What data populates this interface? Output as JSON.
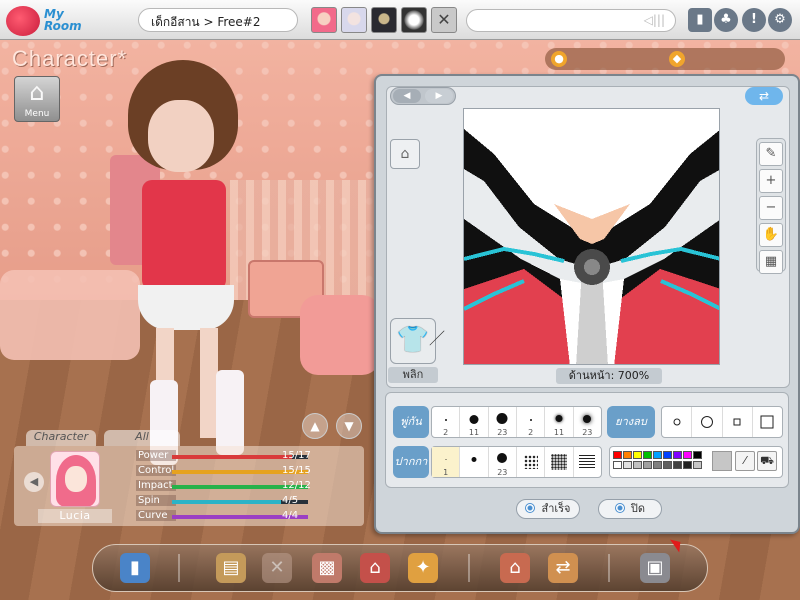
{
  "topbar": {
    "logo_text": "My Room",
    "room_title": "เด็กอีสาน > Free#2",
    "chat_placeholder": "",
    "avatars": [
      "pink-hair-avatar",
      "white-hair-avatar",
      "dark-avatar",
      "gray-avatar"
    ],
    "close_glyph": "✕"
  },
  "left": {
    "heading": "Character*",
    "menu_label": "Menu",
    "tabs": [
      "Character",
      "All"
    ],
    "character_name": "Lucia",
    "stats": [
      {
        "name": "Power",
        "value": "15/17",
        "fraction": 0.88,
        "color": "#d93a3a"
      },
      {
        "name": "Control",
        "value": "15/15",
        "fraction": 1.0,
        "color": "#e6a21f"
      },
      {
        "name": "Impact",
        "value": "12/12",
        "fraction": 1.0,
        "color": "#27b24a"
      },
      {
        "name": "Spin",
        "value": "4/5",
        "fraction": 0.8,
        "color": "#2bb3c7"
      },
      {
        "name": "Curve",
        "value": "4/4",
        "fraction": 1.0,
        "color": "#9b3fc4"
      }
    ]
  },
  "editor": {
    "flip_label": "พลิก",
    "canvas_caption": "ด้านหน้า: 700%",
    "brush_label": "พู่กัน",
    "pen_label": "ปากกา",
    "eraser_label": "ยางลบ",
    "brush_sizes": [
      "2",
      "11",
      "23",
      "2",
      "11",
      "23"
    ],
    "pen_sizes": [
      "1",
      "",
      "23",
      "",
      "",
      ""
    ],
    "ok_label": "สำเร็จ",
    "close_label": "ปิด",
    "palette": [
      "#ff0000",
      "#ff8000",
      "#ffff00",
      "#00c000",
      "#00a0ff",
      "#0040ff",
      "#8000ff",
      "#ff00ff",
      "#000000",
      "#ffffff",
      "#e0e0e0",
      "#c0c0c0",
      "#a0a0a0",
      "#808080",
      "#606060",
      "#404040",
      "#202020",
      "#c6c6c6"
    ]
  }
}
